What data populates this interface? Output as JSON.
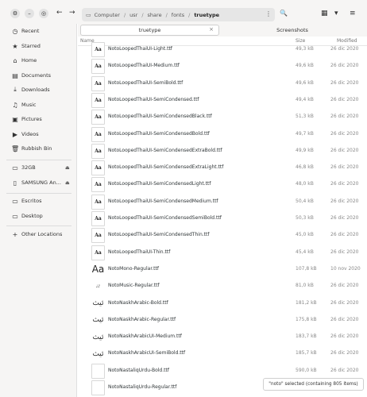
{
  "header": {
    "window_controls": [
      {
        "name": "settings-icon",
        "glyph": "⚙"
      },
      {
        "name": "minimize-icon",
        "glyph": "–"
      },
      {
        "name": "restore-icon",
        "glyph": "◎"
      }
    ],
    "back_glyph": "←",
    "forward_glyph": "→",
    "path": [
      "Computer",
      "usr",
      "share",
      "fonts",
      "truetype"
    ],
    "path_menu_glyph": "⋮",
    "search_glyph": "🔍",
    "view_glyph": "▦",
    "view_dropdown_glyph": "▾",
    "menu_glyph": "≡"
  },
  "sidebar": {
    "items": [
      {
        "icon": "clock-icon",
        "glyph": "◷",
        "label": "Recent"
      },
      {
        "icon": "star-icon",
        "glyph": "★",
        "label": "Starred"
      },
      {
        "icon": "home-icon",
        "glyph": "⌂",
        "label": "Home"
      },
      {
        "icon": "document-icon",
        "glyph": "▤",
        "label": "Documents"
      },
      {
        "icon": "download-icon",
        "glyph": "⤓",
        "label": "Downloads"
      },
      {
        "icon": "music-icon",
        "glyph": "♫",
        "label": "Music"
      },
      {
        "icon": "picture-icon",
        "glyph": "▣",
        "label": "Pictures"
      },
      {
        "icon": "video-icon",
        "glyph": "▶",
        "label": "Videos"
      },
      {
        "icon": "trash-icon",
        "glyph": "🗑",
        "label": "Rubbish Bin"
      }
    ],
    "devices": [
      {
        "icon": "drive-icon",
        "glyph": "▭",
        "label": "32GB",
        "eject": "⏏"
      },
      {
        "icon": "phone-icon",
        "glyph": "▯",
        "label": "SAMSUNG An...",
        "eject": "⏏"
      }
    ],
    "bookmarks": [
      {
        "icon": "folder-icon",
        "glyph": "▭",
        "label": "Escritos"
      },
      {
        "icon": "desktop-icon",
        "glyph": "▭",
        "label": "Desktop"
      }
    ],
    "other": {
      "icon": "plus-icon",
      "glyph": "+",
      "label": "Other Locations"
    }
  },
  "tabs": [
    {
      "label": "truetype",
      "close": "×"
    },
    {
      "label": "Screenshots"
    }
  ],
  "columns": {
    "name": "Name",
    "size": "Size",
    "modified": "Modified"
  },
  "files": [
    {
      "icon": "Aa",
      "name": "NotoLoopedThaiUI-Light.ttf",
      "size": "49,3 kB",
      "date": "26 dic 2020"
    },
    {
      "icon": "Aa",
      "name": "NotoLoopedThaiUI-Medium.ttf",
      "size": "49,6 kB",
      "date": "26 dic 2020"
    },
    {
      "icon": "Aa",
      "name": "NotoLoopedThaiUI-SemiBold.ttf",
      "size": "49,6 kB",
      "date": "26 dic 2020"
    },
    {
      "icon": "Aa",
      "name": "NotoLoopedThaiUI-SemiCondensed.ttf",
      "size": "49,4 kB",
      "date": "26 dic 2020"
    },
    {
      "icon": "Aa",
      "name": "NotoLoopedThaiUI-SemiCondensedBlack.ttf",
      "size": "51,3 kB",
      "date": "26 dic 2020"
    },
    {
      "icon": "Aa",
      "name": "NotoLoopedThaiUI-SemiCondensedBold.ttf",
      "size": "49,7 kB",
      "date": "26 dic 2020"
    },
    {
      "icon": "Aa",
      "name": "NotoLoopedThaiUI-SemiCondensedExtraBold.ttf",
      "size": "49,9 kB",
      "date": "26 dic 2020"
    },
    {
      "icon": "Aa",
      "name": "NotoLoopedThaiUI-SemiCondensedExtraLight.ttf",
      "size": "46,8 kB",
      "date": "26 dic 2020"
    },
    {
      "icon": "Aa",
      "name": "NotoLoopedThaiUI-SemiCondensedLight.ttf",
      "size": "48,0 kB",
      "date": "26 dic 2020"
    },
    {
      "icon": "Aa",
      "name": "NotoLoopedThaiUI-SemiCondensedMedium.ttf",
      "size": "50,4 kB",
      "date": "26 dic 2020"
    },
    {
      "icon": "Aa",
      "name": "NotoLoopedThaiUI-SemiCondensedSemiBold.ttf",
      "size": "50,3 kB",
      "date": "26 dic 2020"
    },
    {
      "icon": "Aa",
      "name": "NotoLoopedThaiUI-SemiCondensedThin.ttf",
      "size": "45,0 kB",
      "date": "26 dic 2020"
    },
    {
      "icon": "Aa",
      "name": "NotoLoopedThaiUI-Thin.ttf",
      "size": "45,4 kB",
      "date": "26 dic 2020"
    },
    {
      "icon": "Aa",
      "name": "NotoMono-Regular.ttf",
      "size": "107,8 kB",
      "date": "10 nov 2020"
    },
    {
      "icon": "♩♪",
      "name": "NotoMusic-Regular.ttf",
      "size": "81,0 kB",
      "date": "26 dic 2020"
    },
    {
      "icon": "ئيث",
      "name": "NotoNaskhArabic-Bold.ttf",
      "size": "181,2 kB",
      "date": "26 dic 2020"
    },
    {
      "icon": "ئيث",
      "name": "NotoNaskhArabic-Regular.ttf",
      "size": "175,8 kB",
      "date": "26 dic 2020"
    },
    {
      "icon": "ئيث",
      "name": "NotoNaskhArabicUI-Medium.ttf",
      "size": "183,7 kB",
      "date": "26 dic 2020"
    },
    {
      "icon": "ئيث",
      "name": "NotoNaskhArabicUI-SemiBold.ttf",
      "size": "185,7 kB",
      "date": "26 dic 2020"
    },
    {
      "icon": "",
      "name": "NotoNastaliqUrdu-Bold.ttf",
      "size": "590,0 kB",
      "date": "26 dic 2020"
    },
    {
      "icon": "",
      "name": "NotoNastaliqUrdu-Regular.ttf",
      "size": "",
      "date": ""
    }
  ],
  "status": "\"noto\" selected (containing 805 items)"
}
